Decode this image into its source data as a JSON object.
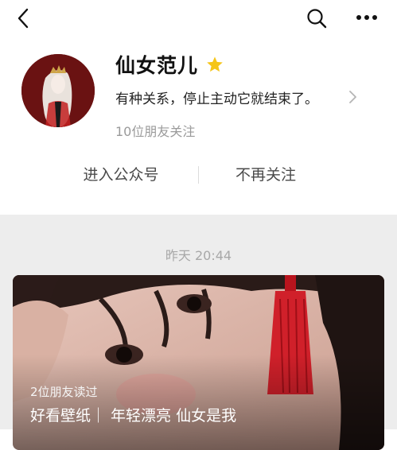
{
  "nav": {
    "back_icon": "chevron-left-icon",
    "search_icon": "search-icon",
    "more_icon": "more-horizontal-icon"
  },
  "account": {
    "name": "仙女范儿",
    "badge_icon": "star-icon",
    "badge_color": "#f5c518",
    "description": "有种关系，停止主动它就结束了。",
    "followers_text": "10位朋友关注"
  },
  "actions": {
    "enter_label": "进入公众号",
    "unfollow_label": "不再关注"
  },
  "feed": {
    "timestamp": "昨天 20:44",
    "article": {
      "friends_read": "2位朋友读过",
      "title": "好看壁纸｜ 年轻漂亮 仙女是我"
    }
  },
  "colors": {
    "feed_background": "#ededed",
    "secondary_text": "#9a9a9a",
    "avatar_background": "#6a1212",
    "tassel_red": "#d0202a"
  }
}
